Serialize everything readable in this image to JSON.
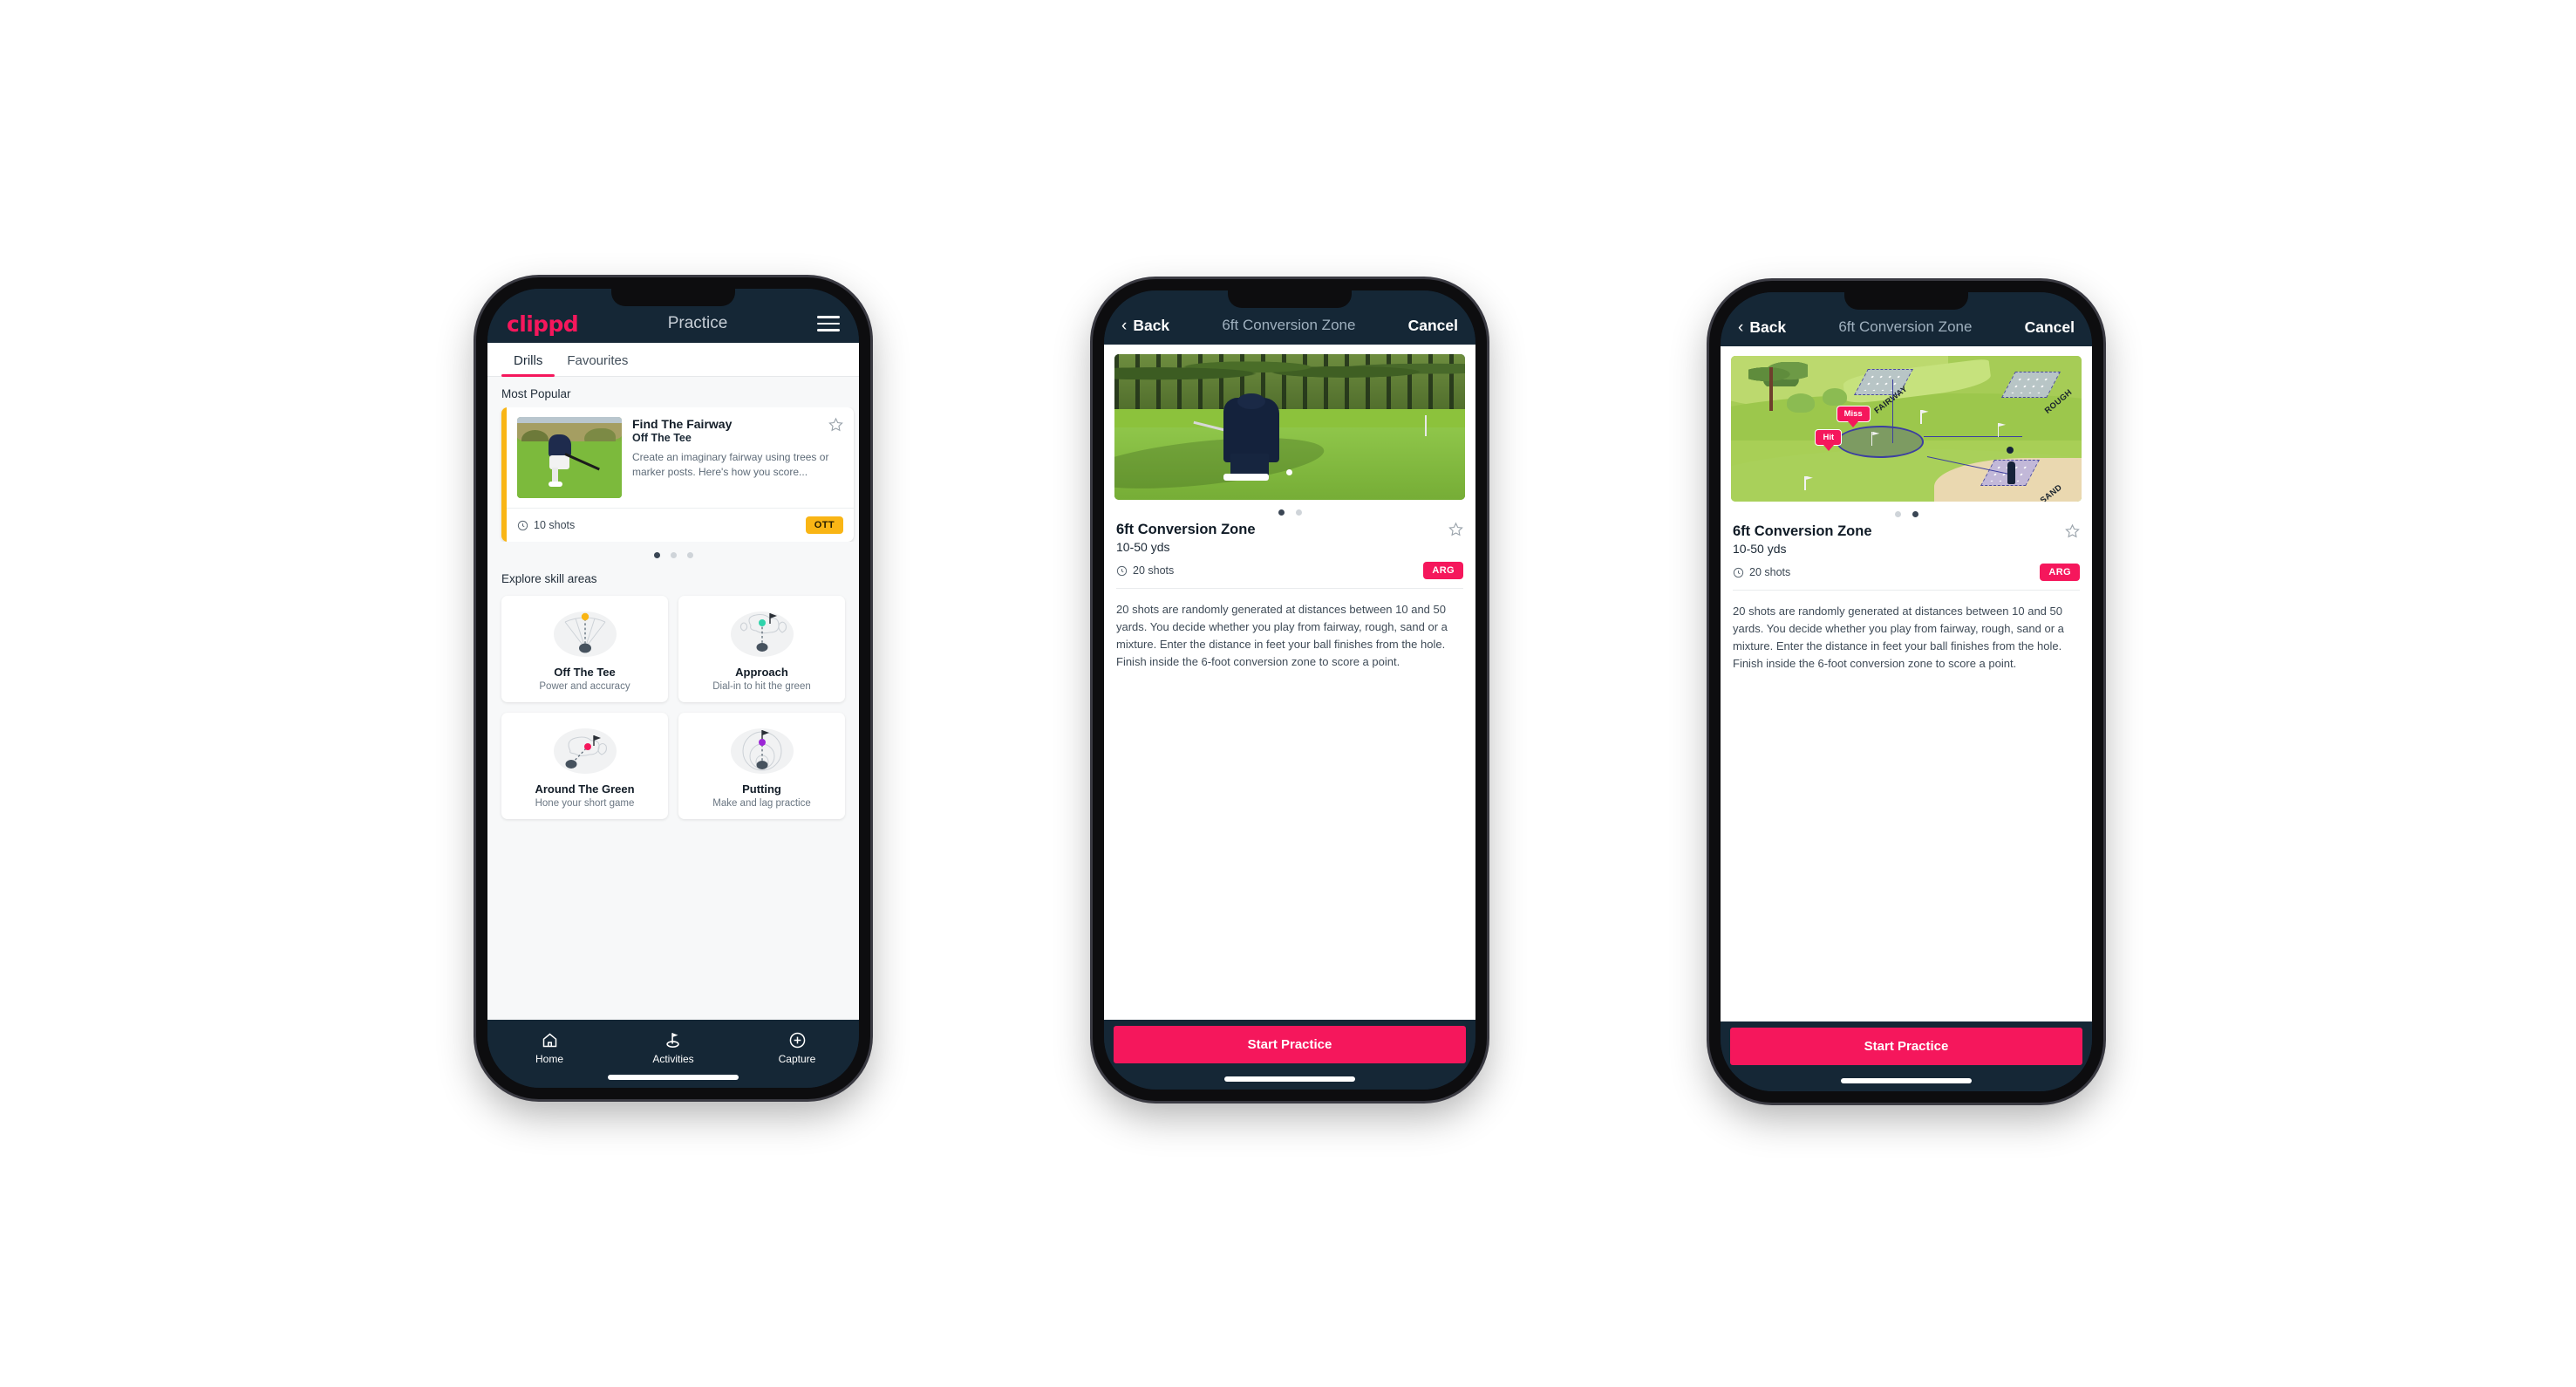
{
  "app": {
    "brand": "clippd",
    "accent_pink": "#f5175c",
    "dark_navy": "#152736",
    "amber": "#f9b515",
    "teal": "#3fd6b0"
  },
  "phone1": {
    "appbar": {
      "title": "Practice",
      "menu_icon": "hamburger-menu-icon"
    },
    "tabs": [
      {
        "label": "Drills",
        "active": true
      },
      {
        "label": "Favourites",
        "active": false
      }
    ],
    "most_popular": {
      "section_label": "Most Popular",
      "card": {
        "title": "Find The Fairway",
        "subtitle": "Off The Tee",
        "description": "Create an imaginary fairway using trees or marker posts. Here's how you score...",
        "shots": "10 shots",
        "badge": "OTT",
        "accent_color": "#f9b515",
        "favourite_icon": "star-outline-icon"
      },
      "next_card_accent": "#3fd6b0",
      "dots": {
        "count": 3,
        "active": 0
      }
    },
    "skill_areas": {
      "section_label": "Explore skill areas",
      "items": [
        {
          "name": "Off The Tee",
          "desc": "Power and accuracy",
          "icon": "tee-fan-icon",
          "dot_color": "#f9b515"
        },
        {
          "name": "Approach",
          "desc": "Dial-in to hit the green",
          "icon": "approach-green-icon",
          "dot_color": "#2fd3ab"
        },
        {
          "name": "Around The Green",
          "desc": "Hone your short game",
          "icon": "chip-green-icon",
          "dot_color": "#f5175c"
        },
        {
          "name": "Putting",
          "desc": "Make and lag practice",
          "icon": "putting-rings-icon",
          "dot_color": "#9c27d6"
        }
      ]
    },
    "tabbar": [
      {
        "label": "Home",
        "icon": "home-icon",
        "active": false
      },
      {
        "label": "Activities",
        "icon": "golf-flag-icon",
        "active": true
      },
      {
        "label": "Capture",
        "icon": "plus-circle-icon",
        "active": false
      }
    ]
  },
  "phone2": {
    "navbar": {
      "back": "Back",
      "title": "6ft Conversion Zone",
      "cancel": "Cancel",
      "back_icon": "chevron-left-icon"
    },
    "hero": {
      "type": "photo",
      "alt": "golfer-chipping-photo"
    },
    "dots": {
      "count": 2,
      "active": 0
    },
    "detail": {
      "title": "6ft Conversion Zone",
      "yards": "10-50 yds",
      "shots": "20 shots",
      "badge": "ARG",
      "favourite_icon": "star-outline-icon",
      "description": "20 shots are randomly generated at distances between 10 and 50 yards. You decide whether you play from fairway, rough, sand or a mixture. Enter the distance in feet your ball finishes from the hole. Finish inside the 6-foot conversion zone to score a point."
    },
    "cta": "Start Practice"
  },
  "phone3": {
    "navbar": {
      "back": "Back",
      "title": "6ft Conversion Zone",
      "cancel": "Cancel",
      "back_icon": "chevron-left-icon"
    },
    "hero": {
      "type": "illustration",
      "alt": "course-map-illustration",
      "labels": [
        "FAIRWAY",
        "ROUGH",
        "SAND"
      ],
      "pills": [
        "Miss",
        "Hit"
      ]
    },
    "dots": {
      "count": 2,
      "active": 1
    },
    "detail": {
      "title": "6ft Conversion Zone",
      "yards": "10-50 yds",
      "shots": "20 shots",
      "badge": "ARG",
      "favourite_icon": "star-outline-icon",
      "description": "20 shots are randomly generated at distances between 10 and 50 yards. You decide whether you play from fairway, rough, sand or a mixture. Enter the distance in feet your ball finishes from the hole. Finish inside the 6-foot conversion zone to score a point."
    },
    "cta": "Start Practice"
  }
}
